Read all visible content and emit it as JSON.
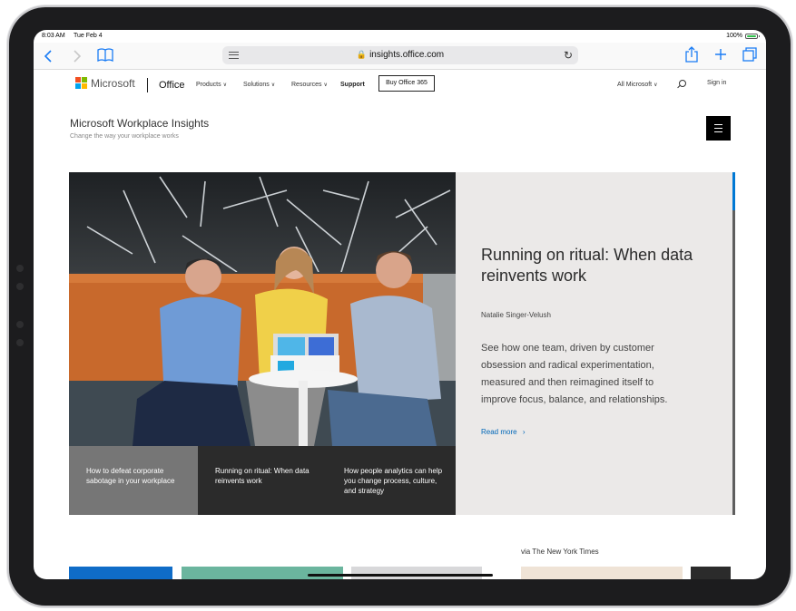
{
  "status_bar": {
    "time": "8:03 AM",
    "date": "Tue Feb 4",
    "battery": "100%"
  },
  "browser": {
    "url": "insights.office.com"
  },
  "site_nav": {
    "brand": "Microsoft",
    "product": "Office",
    "items": [
      {
        "label": "Products",
        "has_menu": true
      },
      {
        "label": "Solutions",
        "has_menu": true
      },
      {
        "label": "Resources",
        "has_menu": true
      },
      {
        "label": "Support",
        "has_menu": false
      }
    ],
    "buy_button": "Buy Office 365",
    "all_microsoft": "All Microsoft",
    "sign_in": "Sign in",
    "logo_colors": [
      "#f25022",
      "#7fba00",
      "#00a4ef",
      "#ffb900"
    ]
  },
  "header": {
    "title": "Microsoft Workplace Insights",
    "subtitle": "Change the way your workplace works"
  },
  "hero": {
    "title": "Running on ritual: When data reinvents work",
    "author": "Natalie Singer-Velush",
    "description": "See how one team, driven by customer obsession and radical experimentation, measured and then reimagined itself to improve focus, balance, and relationships.",
    "read_more": "Read more",
    "accent": "#0078d4"
  },
  "tiles": [
    {
      "label": "How to defeat corporate sabotage in your workplace",
      "active": false
    },
    {
      "label": "Running on ritual: When data reinvents work",
      "active": true
    },
    {
      "label": "How people analytics can help you change process, culture, and strategy",
      "active": false
    }
  ],
  "lower": {
    "source": "via The New York Times"
  }
}
